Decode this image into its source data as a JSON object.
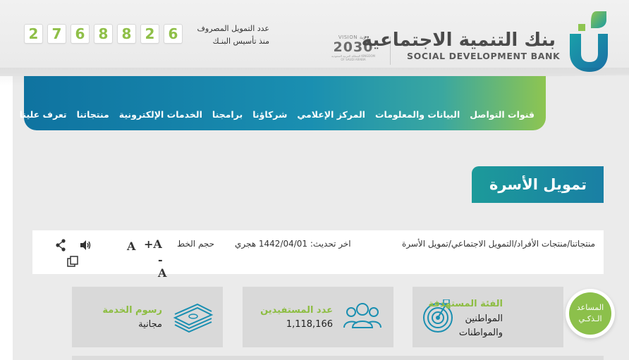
{
  "header": {
    "counter_digits": [
      "2",
      "7",
      "6",
      "8",
      "8",
      "2",
      "6"
    ],
    "counter_caption_line1": "عدد التمويل المصروف",
    "counter_caption_line2": "منذ تأسيس البنـك",
    "vision_top": "VISION رؤية",
    "vision_year": "2030",
    "vision_sub": "المملكة العربية السعودية KINGDOM OF SAUDI ARABIA",
    "bank_name_ar": "بنك التنمية الاجتماعية",
    "bank_name_en": "SOCIAL DEVELOPMENT BANK"
  },
  "nav": {
    "items": [
      "تعرف علينا",
      "منتجاتنا",
      "الخدمات الإلكترونية",
      "برامجنا",
      "شركاؤنا",
      "المركز الإعلامي",
      "البيانات والمعلومات",
      "قنوات التواصل"
    ]
  },
  "page": {
    "title": "تمويل الأسرة"
  },
  "infobar": {
    "breadcrumb": "منتجاتنا/منتجات الأفراد/التمويل الاجتماعي/تمويل الأسرة",
    "updated": "اخر تحديث: 1442/04/01 هجري",
    "font_size_label": "حجم الخط",
    "font_increase": "+A",
    "font_normal": "A",
    "font_decrease": "-A"
  },
  "cards": [
    {
      "title": "الفئة المستهدفة",
      "value_line1": "المواطنين",
      "value_line2": "والمواطنات",
      "icon": "target-icon"
    },
    {
      "title": "عدد المستفيدين",
      "value_line1": "1,118,166",
      "icon": "users-icon"
    },
    {
      "title": "رسوم الخدمة",
      "value_line1": "مجانية",
      "icon": "money-stack-icon"
    }
  ],
  "assistant": {
    "line1": "المساعد",
    "line2": "الـذكـي"
  },
  "colors": {
    "brand_teal": "#1a8fb1",
    "brand_green": "#8dbd42",
    "digit_green": "#8fbf48"
  }
}
